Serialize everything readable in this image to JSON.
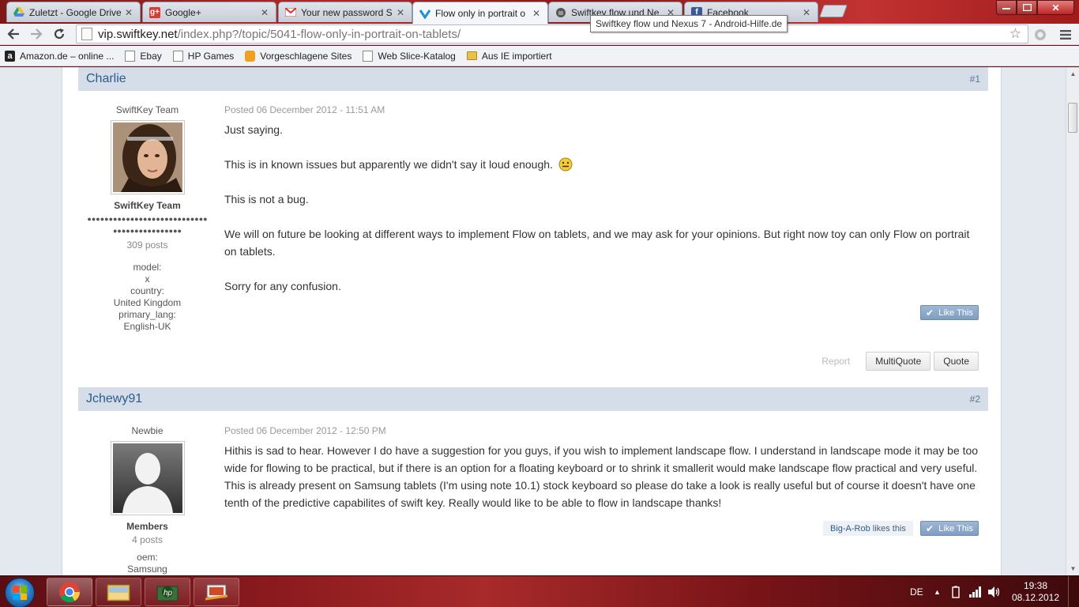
{
  "browser": {
    "tabs": [
      {
        "title": "Zuletzt - Google Drive",
        "icon": "drive-icon",
        "active": false
      },
      {
        "title": "Google+",
        "icon": "googleplus-icon",
        "active": false
      },
      {
        "title": "Your new password S",
        "icon": "gmail-icon",
        "active": false
      },
      {
        "title": "Flow only in portrait o",
        "icon": "swiftkey-icon",
        "active": true
      },
      {
        "title": "Swiftkey flow und Ne",
        "icon": "android-icon",
        "active": false
      },
      {
        "title": "Facebook",
        "icon": "facebook-icon",
        "active": false
      }
    ],
    "tooltip": "Swiftkey flow und Nexus 7 - Android-Hilfe.de",
    "url_host": "vip.swiftkey.net",
    "url_path": "/index.php?/topic/5041-flow-only-in-portrait-on-tablets/",
    "bookmarks": [
      {
        "label": "Amazon.de – online ...",
        "icon": "amazon-icon"
      },
      {
        "label": "Ebay",
        "icon": "page-icon"
      },
      {
        "label": "HP Games",
        "icon": "page-icon"
      },
      {
        "label": "Vorgeschlagene Sites",
        "icon": "suggested-sites-icon"
      },
      {
        "label": "Web Slice-Katalog",
        "icon": "page-icon"
      },
      {
        "label": "Aus IE importiert",
        "icon": "folder-icon"
      }
    ]
  },
  "posts": [
    {
      "author": "Charlie",
      "number": "#1",
      "rank": "SwiftKey Team",
      "group": "SwiftKey Team",
      "pips": "●●●●●●●●●●●●●●●●●●●●●●●●●●●●●●●●●●●●●●●●●●●●",
      "posts_count": "309 posts",
      "fields": [
        "model:",
        "x",
        "country:",
        "United Kingdom",
        "primary_lang:",
        "English-UK"
      ],
      "posted": "Posted 06 December 2012 - 11:51 AM",
      "paragraphs": [
        "Just saying.",
        "This is in known issues but apparently we didn't say it loud enough.",
        "This is not a bug.",
        "We will on future be looking at different ways to implement Flow on tablets, and we may ask for your opinions. But right now toy can only Flow on portrait on tablets.",
        "Sorry for any confusion."
      ],
      "like_label": "Like This",
      "report_label": "Report",
      "multiquote_label": "MultiQuote",
      "quote_label": "Quote"
    },
    {
      "author": "Jchewy91",
      "number": "#2",
      "rank": "Newbie",
      "group": "Members",
      "posts_count": "4 posts",
      "fields": [
        "oem:",
        "Samsung"
      ],
      "posted": "Posted 06 December 2012 - 12:50 PM",
      "paragraphs": [
        "Hithis is sad to hear. However I do have a suggestion for you guys, if you wish to implement landscape flow. I understand in landscape mode it may be too wide for flowing to be practical, but if there is an option for a floating keyboard or to shrink it smallerit would make landscape flow practical and very useful. This is already present on Samsung tablets (I'm using note 10.1) stock keyboard so please do take a look is really useful but of course it doesn't have one tenth of the predictive capabilites of swift key. Really would like to be able to flow in landscape thanks!"
      ],
      "liker": "Big-A-Rob",
      "likes_suffix": "likes this",
      "like_label": "Like This"
    }
  ],
  "taskbar": {
    "language": "DE",
    "time": "19:38",
    "date": "08.12.2012"
  }
}
